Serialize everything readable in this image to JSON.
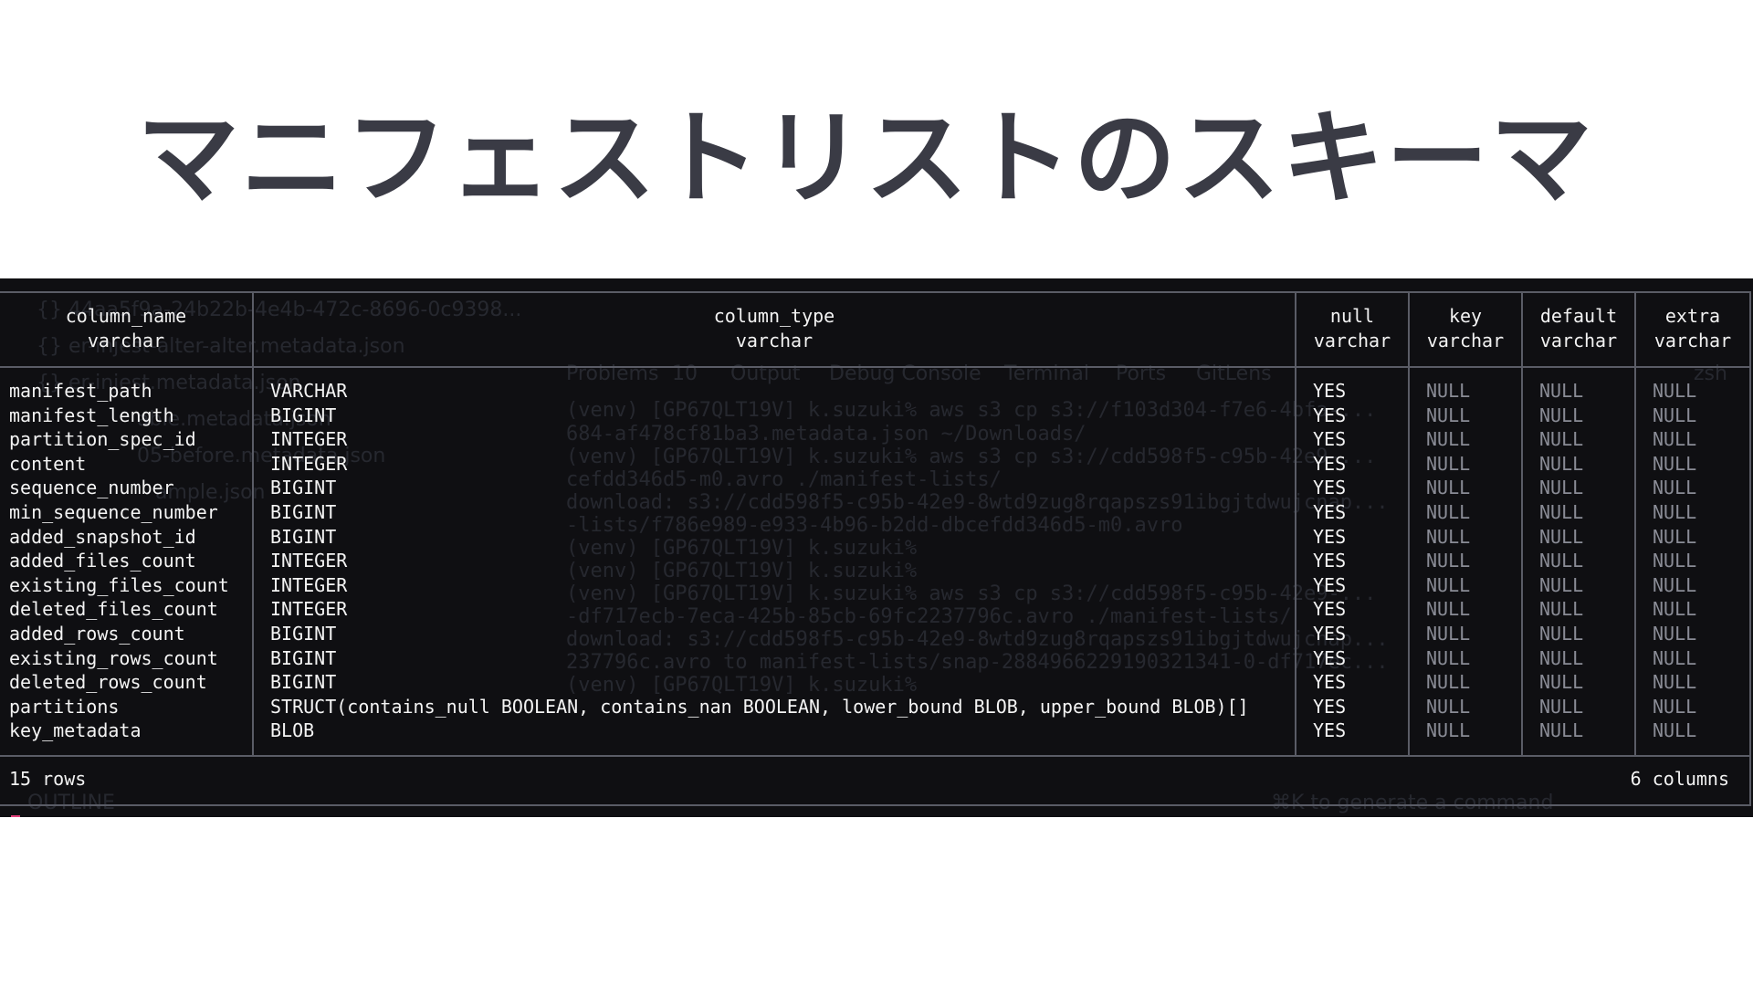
{
  "slide": {
    "title": "マニフェストリストのスキーマ"
  },
  "table": {
    "headers": [
      {
        "name": "column_name",
        "type": "varchar"
      },
      {
        "name": "column_type",
        "type": "varchar"
      },
      {
        "name": "null",
        "type": "varchar"
      },
      {
        "name": "key",
        "type": "varchar"
      },
      {
        "name": "default",
        "type": "varchar"
      },
      {
        "name": "extra",
        "type": "varchar"
      }
    ],
    "rows": [
      [
        "manifest_path",
        "VARCHAR",
        "YES",
        "NULL",
        "NULL",
        "NULL"
      ],
      [
        "manifest_length",
        "BIGINT",
        "YES",
        "NULL",
        "NULL",
        "NULL"
      ],
      [
        "partition_spec_id",
        "INTEGER",
        "YES",
        "NULL",
        "NULL",
        "NULL"
      ],
      [
        "content",
        "INTEGER",
        "YES",
        "NULL",
        "NULL",
        "NULL"
      ],
      [
        "sequence_number",
        "BIGINT",
        "YES",
        "NULL",
        "NULL",
        "NULL"
      ],
      [
        "min_sequence_number",
        "BIGINT",
        "YES",
        "NULL",
        "NULL",
        "NULL"
      ],
      [
        "added_snapshot_id",
        "BIGINT",
        "YES",
        "NULL",
        "NULL",
        "NULL"
      ],
      [
        "added_files_count",
        "INTEGER",
        "YES",
        "NULL",
        "NULL",
        "NULL"
      ],
      [
        "existing_files_count",
        "INTEGER",
        "YES",
        "NULL",
        "NULL",
        "NULL"
      ],
      [
        "deleted_files_count",
        "INTEGER",
        "YES",
        "NULL",
        "NULL",
        "NULL"
      ],
      [
        "added_rows_count",
        "BIGINT",
        "YES",
        "NULL",
        "NULL",
        "NULL"
      ],
      [
        "existing_rows_count",
        "BIGINT",
        "YES",
        "NULL",
        "NULL",
        "NULL"
      ],
      [
        "deleted_rows_count",
        "BIGINT",
        "YES",
        "NULL",
        "NULL",
        "NULL"
      ],
      [
        "partitions",
        "STRUCT(contains_null BOOLEAN, contains_nan BOOLEAN, lower_bound BLOB, upper_bound BLOB)[]",
        "YES",
        "NULL",
        "NULL",
        "NULL"
      ],
      [
        "key_metadata",
        "BLOB",
        "YES",
        "NULL",
        "NULL",
        "NULL"
      ]
    ],
    "footer": {
      "row_count": "15 rows",
      "column_count": "6 columns"
    }
  },
  "background": {
    "file_items": [
      "{} 44aa5f9a-24b22b-4e4b-472c-8696-0c9398...",
      "{} er-injest-alter-alter.metadata.json",
      "{} er-injest.metadata.json",
      "able.metadata.json",
      "05-before.metadata.json",
      "ample.json"
    ],
    "panel_tabs": [
      "Problems",
      "Output",
      "Debug Console",
      "Terminal",
      "Ports",
      "GitLens"
    ],
    "problems_count": "10",
    "shell_label": "zsh",
    "terminal_lines": [
      "(venv) [GP67QLT19V] k.suzuki% aws s3 cp s3://f103d304-f7e6-4bfa-...",
      "684-af478cf81ba3.metadata.json ~/Downloads/",
      "(venv) [GP67QLT19V] k.suzuki% aws s3 cp s3://cdd598f5-c95b-42e9-...",
      "cefdd346d5-m0.avro ./manifest-lists/",
      "download: s3://cdd598f5-c95b-42e9-8wtd9zug8rqapszs91ibgjtdwujcnap...",
      "-lists/f786e989-e933-4b96-b2dd-dbcefdd346d5-m0.avro",
      "(venv) [GP67QLT19V] k.suzuki%",
      "(venv) [GP67QLT19V] k.suzuki%",
      "(venv) [GP67QLT19V] k.suzuki% aws s3 cp s3://cdd598f5-c95b-42e9-...",
      "-df717ecb-7eca-425b-85cb-69fc2237796c.avro ./manifest-lists/",
      "download: s3://cdd598f5-c95b-42e9-8wtd9zug8rqapszs91ibgjtdwujcnap...",
      "237796c.avro to manifest-lists/snap-2884966229190321341-0-df717ec...",
      "(venv) [GP67QLT19V] k.suzuki% "
    ],
    "outline_label": "OUTLINE",
    "hint": "⌘K to generate a command"
  }
}
